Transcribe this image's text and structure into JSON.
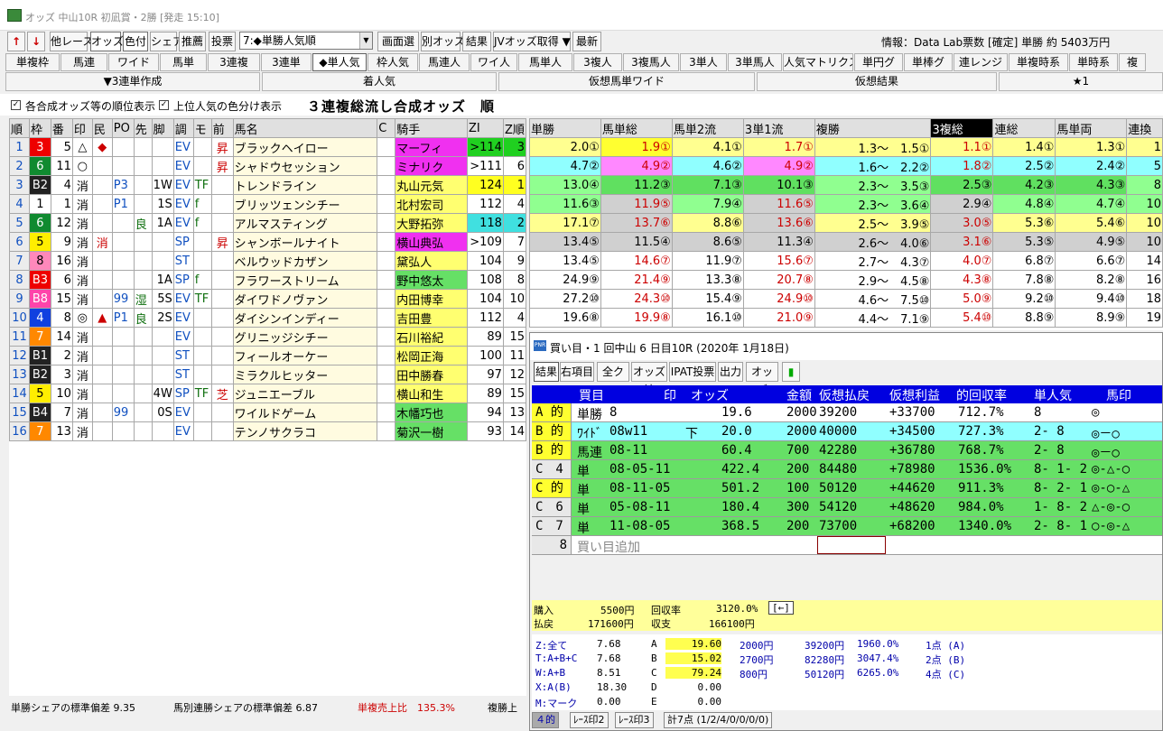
{
  "window": {
    "title": "オッズ 中山10R 初凪賞・2勝 [発走 15:10]"
  },
  "toolbar": {
    "other_race": "他レース",
    "odds": "オッズ",
    "color": "色付",
    "share": "シェア",
    "pick": "推薦",
    "vote": "投票",
    "sort_combo": "7:◆単勝人気順",
    "screen_select": "画面選",
    "other_odds": "別オッズ",
    "result": "結果",
    "jv_get": "JVオッズ取得 ▼",
    "latest": "最新"
  },
  "info_text": "情報：Data Lab票数 [確定] 単勝 約 5403万円",
  "tabs": [
    "単複枠",
    "馬連",
    "ワイド",
    "馬単",
    "3連複",
    "3連単",
    "◆単人気",
    "枠人気",
    "馬連人",
    "ワイ人",
    "馬単人",
    "3複人",
    "3複馬人",
    "3単人",
    "3単馬人",
    "人気マトリクス",
    "単円グ",
    "単棒グ",
    "連レンジ",
    "単複時系",
    "単時系",
    "複"
  ],
  "selected_tab": "◆単人気",
  "menus": [
    "▼3連単作成",
    "着人気",
    "仮想馬単ワイド",
    "仮想結果",
    "★1"
  ],
  "options": {
    "opt1": "各合成オッズ等の順位表示",
    "opt2": "上位人気の色分け表示",
    "title": "３連複総流し合成オッズ　順"
  },
  "left_headers": [
    "順",
    "枠",
    "番",
    "印",
    "民",
    "PO",
    "先",
    "脚",
    "調",
    "モ",
    "前",
    "馬名",
    "C",
    "騎手",
    "ZI",
    "Z順"
  ],
  "horses": [
    {
      "jun": "1",
      "waku": "3",
      "ban": "5",
      "shirushi": "△",
      "min": "◆",
      "po": "",
      "saki": "",
      "kyaku": "",
      "cho": "EV",
      "mo": "",
      "mae": "昇",
      "name": "ブラックヘイロー",
      "c": "",
      "jockey": "マーフィ",
      "zi": ">114",
      "zj": "3"
    },
    {
      "jun": "2",
      "waku": "6",
      "ban": "11",
      "shirushi": "○",
      "min": "",
      "po": "",
      "saki": "",
      "kyaku": "",
      "cho": "EV",
      "mo": "",
      "mae": "昇",
      "name": "シャドウセッション",
      "c": "",
      "jockey": "ミナリク",
      "zi": ">111",
      "zj": "6"
    },
    {
      "jun": "3",
      "waku": "B2",
      "ban": "4",
      "shirushi": "消",
      "min": "",
      "po": "P3",
      "saki": "",
      "kyaku": "1W",
      "cho": "EV",
      "mo": "TF",
      "mae": "",
      "name": "トレンドライン",
      "c": "",
      "jockey": "丸山元気",
      "zi": "124",
      "zj": "1"
    },
    {
      "jun": "4",
      "waku": "1",
      "ban": "1",
      "shirushi": "消",
      "min": "",
      "po": "P1",
      "saki": "",
      "kyaku": "1S",
      "cho": "EV",
      "mo": "f",
      "mae": "",
      "name": "ブリッツェンシチー",
      "c": "",
      "jockey": "北村宏司",
      "zi": "112",
      "zj": "4"
    },
    {
      "jun": "5",
      "waku": "6",
      "ban": "12",
      "shirushi": "消",
      "min": "",
      "po": "",
      "saki": "良",
      "kyaku": "1A",
      "cho": "EV",
      "mo": "f",
      "mae": "",
      "name": "アルマスティング",
      "c": "",
      "jockey": "大野拓弥",
      "zi": "118",
      "zj": "2"
    },
    {
      "jun": "6",
      "waku": "5",
      "ban": "9",
      "shirushi": "消",
      "min": "消",
      "po": "",
      "saki": "",
      "kyaku": "",
      "cho": "SP",
      "mo": "",
      "mae": "昇",
      "name": "シャンボールナイト",
      "c": "",
      "jockey": "横山典弘",
      "zi": ">109",
      "zj": "7"
    },
    {
      "jun": "7",
      "waku": "8",
      "ban": "16",
      "shirushi": "消",
      "min": "",
      "po": "",
      "saki": "",
      "kyaku": "",
      "cho": "ST",
      "mo": "",
      "mae": "",
      "name": "ベルウッドカザン",
      "c": "",
      "jockey": "黛弘人",
      "zi": "104",
      "zj": "9"
    },
    {
      "jun": "8",
      "waku": "B3",
      "ban": "6",
      "shirushi": "消",
      "min": "",
      "po": "",
      "saki": "",
      "kyaku": "1A",
      "cho": "SP",
      "mo": "f",
      "mae": "",
      "name": "フラワーストリーム",
      "c": "",
      "jockey": "野中悠太",
      "zi": "108",
      "zj": "8"
    },
    {
      "jun": "9",
      "waku": "B8",
      "ban": "15",
      "shirushi": "消",
      "min": "",
      "po": "99",
      "saki": "湿",
      "kyaku": "5S",
      "cho": "EV",
      "mo": "TF",
      "mae": "",
      "name": "ダイワドノヴァン",
      "c": "",
      "jockey": "内田博幸",
      "zi": "104",
      "zj": "10"
    },
    {
      "jun": "10",
      "waku": "4",
      "ban": "8",
      "shirushi": "◎",
      "min": "▲",
      "po": "P1",
      "saki": "良",
      "kyaku": "2S",
      "cho": "EV",
      "mo": "",
      "mae": "",
      "name": "ダイシンインディー",
      "c": "",
      "jockey": "吉田豊",
      "zi": "112",
      "zj": "4"
    },
    {
      "jun": "11",
      "waku": "7",
      "ban": "14",
      "shirushi": "消",
      "min": "",
      "po": "",
      "saki": "",
      "kyaku": "",
      "cho": "EV",
      "mo": "",
      "mae": "",
      "name": "グリニッジシチー",
      "c": "",
      "jockey": "石川裕紀",
      "zi": "89",
      "zj": "15"
    },
    {
      "jun": "12",
      "waku": "B1",
      "ban": "2",
      "shirushi": "消",
      "min": "",
      "po": "",
      "saki": "",
      "kyaku": "",
      "cho": "ST",
      "mo": "",
      "mae": "",
      "name": "フィールオーケー",
      "c": "",
      "jockey": "松岡正海",
      "zi": "100",
      "zj": "11"
    },
    {
      "jun": "13",
      "waku": "B2",
      "ban": "3",
      "shirushi": "消",
      "min": "",
      "po": "",
      "saki": "",
      "kyaku": "",
      "cho": "ST",
      "mo": "",
      "mae": "",
      "name": "ミラクルヒッター",
      "c": "",
      "jockey": "田中勝春",
      "zi": "97",
      "zj": "12"
    },
    {
      "jun": "14",
      "waku": "5",
      "ban": "10",
      "shirushi": "消",
      "min": "",
      "po": "",
      "saki": "",
      "kyaku": "4W",
      "cho": "SP",
      "mo": "TF",
      "mae": "芝",
      "name": "ジュニエーブル",
      "c": "",
      "jockey": "横山和生",
      "zi": "89",
      "zj": "15"
    },
    {
      "jun": "15",
      "waku": "B4",
      "ban": "7",
      "shirushi": "消",
      "min": "",
      "po": "99",
      "saki": "",
      "kyaku": "0S",
      "cho": "EV",
      "mo": "",
      "mae": "",
      "name": "ワイルドゲーム",
      "c": "",
      "jockey": "木幡巧也",
      "zi": "94",
      "zj": "13"
    },
    {
      "jun": "16",
      "waku": "7",
      "ban": "13",
      "shirushi": "消",
      "min": "",
      "po": "",
      "saki": "",
      "kyaku": "",
      "cho": "EV",
      "mo": "",
      "mae": "",
      "name": "テンノサクラコ",
      "c": "",
      "jockey": "菊沢一樹",
      "zi": "93",
      "zj": "14"
    }
  ],
  "right_headers": [
    "単勝",
    "馬単総",
    "馬単2流",
    "3単1流",
    "複勝",
    "3複総",
    "連総",
    "馬単両",
    "連換"
  ],
  "odds_rows": [
    [
      "2.0①",
      "1.9①",
      "4.1①",
      "1.7①",
      "1.3～　1.5①",
      "1.1①",
      "1.4①",
      "1.3①",
      "1"
    ],
    [
      "4.7②",
      "4.9②",
      "4.6②",
      "4.9②",
      "1.6～　2.2②",
      "1.8②",
      "2.5②",
      "2.4②",
      "5"
    ],
    [
      "13.0④",
      "11.2③",
      "7.1③",
      "10.1③",
      "2.3～　3.5③",
      "2.5③",
      "4.2③",
      "4.3③",
      "8"
    ],
    [
      "11.6③",
      "11.9⑤",
      "7.9④",
      "11.6⑤",
      "2.3～　3.6④",
      "2.9④",
      "4.8④",
      "4.7④",
      "10"
    ],
    [
      "17.1⑦",
      "13.7⑥",
      "8.8⑥",
      "13.6⑥",
      "2.5～　3.9⑤",
      "3.0⑤",
      "5.3⑥",
      "5.4⑥",
      "10"
    ],
    [
      "13.4⑤",
      "11.5④",
      "8.6⑤",
      "11.3④",
      "2.6～　4.0⑥",
      "3.1⑥",
      "5.3⑤",
      "4.9⑤",
      "10"
    ],
    [
      "13.4⑤",
      "14.6⑦",
      "11.9⑦",
      "15.6⑦",
      "2.7～　4.3⑦",
      "4.0⑦",
      "6.8⑦",
      "6.6⑦",
      "14"
    ],
    [
      "24.9⑨",
      "21.4⑨",
      "13.3⑧",
      "20.7⑧",
      "2.9～　4.5⑧",
      "4.3⑧",
      "7.8⑧",
      "8.2⑧",
      "16"
    ],
    [
      "27.2⑩",
      "24.3⑩",
      "15.4⑨",
      "24.9⑩",
      "4.6～　7.5⑩",
      "5.0⑨",
      "9.2⑩",
      "9.4⑩",
      "18"
    ],
    [
      "19.6⑧",
      "19.9⑧",
      "16.1⑩",
      "21.0⑨",
      "4.4～　7.1⑨",
      "5.4⑩",
      "8.8⑨",
      "8.9⑨",
      "19"
    ]
  ],
  "bottom": {
    "t1": "単勝シェアの標準偏差 9.35",
    "t2": "馬別連勝シェアの標準偏差 6.87",
    "t3": "単複売上比　135.3%",
    "t4": "複勝上"
  },
  "popup": {
    "title": "買い目・1 回中山 6 日目10R (2020年 1月18日)",
    "buttons": [
      "結果",
      "右項目",
      "全クリア",
      "オッズ読",
      "IPAT投票",
      "出力",
      "オッズ"
    ],
    "headers": {
      "kaime": "買目",
      "mark": "印",
      "odds": "オッズ",
      "amount": "金額",
      "payout": "仮想払戻",
      "profit": "仮想利益",
      "rate": "的回収率",
      "pop": "単人気",
      "uma": "馬印"
    },
    "bets": [
      {
        "k": "A 的",
        "type": "単勝",
        "combo": "8",
        "mark": "",
        "odds": "19.6",
        "amount": "2000",
        "payout": "39200",
        "profit": "+33700",
        "rate": "712.7%",
        "pop": "8",
        "uma": "◎"
      },
      {
        "k": "B 的",
        "type": "ﾜｲﾄﾞ",
        "combo": "08w11",
        "mark": "下",
        "odds": "20.0",
        "amount": "2000",
        "payout": "40000",
        "profit": "+34500",
        "rate": "727.3%",
        "pop": "2- 8",
        "uma": "◎－○"
      },
      {
        "k": "B 的",
        "type": "馬連",
        "combo": "08-11",
        "mark": "",
        "odds": "60.4",
        "amount": "700",
        "payout": "42280",
        "profit": "+36780",
        "rate": "768.7%",
        "pop": "2- 8",
        "uma": "◎－○"
      },
      {
        "k": "C　4",
        "type": "単",
        "combo": "08-05-11",
        "mark": "",
        "odds": "422.4",
        "amount": "200",
        "payout": "84480",
        "profit": "+78980",
        "rate": "1536.0%",
        "pop": "8- 1- 2",
        "uma": "◎-△-○"
      },
      {
        "k": "C 的",
        "type": "単",
        "combo": "08-11-05",
        "mark": "",
        "odds": "501.2",
        "amount": "100",
        "payout": "50120",
        "profit": "+44620",
        "rate": "911.3%",
        "pop": "8- 2- 1",
        "uma": "◎-○-△"
      },
      {
        "k": "C　6",
        "type": "単",
        "combo": "05-08-11",
        "mark": "",
        "odds": "180.4",
        "amount": "300",
        "payout": "54120",
        "profit": "+48620",
        "rate": "984.0%",
        "pop": "1- 8- 2",
        "uma": "△-◎-○"
      },
      {
        "k": "C　7",
        "type": "単",
        "combo": "11-08-05",
        "mark": "",
        "odds": "368.5",
        "amount": "200",
        "payout": "73700",
        "profit": "+68200",
        "rate": "1340.0%",
        "pop": "2- 8- 1",
        "uma": "○-◎-△"
      }
    ],
    "add_row": {
      "num": "8",
      "label": "買い目追加"
    },
    "summary": {
      "buy_l": "購入",
      "buy": "5500円",
      "rec_l": "回収率",
      "rec": "3120.0%",
      "back": "[←]",
      "pay_l": "払戻",
      "pay": "171600円",
      "bal_l": "収支",
      "bal": "166100円"
    },
    "stats": [
      {
        "l": "Z:全て",
        "v": "7.68",
        "g": "A",
        "gv": "19.60",
        "a": "2000円",
        "p": "39200円",
        "r": "1960.0%",
        "n": "1点 (A)"
      },
      {
        "l": "T:A+B+C",
        "v": "7.68",
        "g": "B",
        "gv": "15.02",
        "a": "2700円",
        "p": "82280円",
        "r": "3047.4%",
        "n": "2点 (B)"
      },
      {
        "l": "W:A+B",
        "v": "8.51",
        "g": "C",
        "gv": "79.24",
        "a": "800円",
        "p": "50120円",
        "r": "6265.0%",
        "n": "4点 (C)"
      },
      {
        "l": "X:A(B)",
        "v": "18.30",
        "g": "D",
        "gv": "0.00",
        "a": "",
        "p": "",
        "r": "",
        "n": ""
      },
      {
        "l": "M:マーク",
        "v": "0.00",
        "g": "E",
        "gv": "0.00",
        "a": "",
        "p": "",
        "r": "",
        "n": ""
      }
    ],
    "ptabs": [
      "４的",
      "ﾚｰｽ印2",
      "ﾚｰｽ印3",
      "計7点 (1/2/4/0/0/0/0)"
    ]
  },
  "colors": {
    "accent_blue": "#0000e0",
    "yellow": "#ffff00",
    "green": "#66e066",
    "cyan": "#66ffff"
  }
}
